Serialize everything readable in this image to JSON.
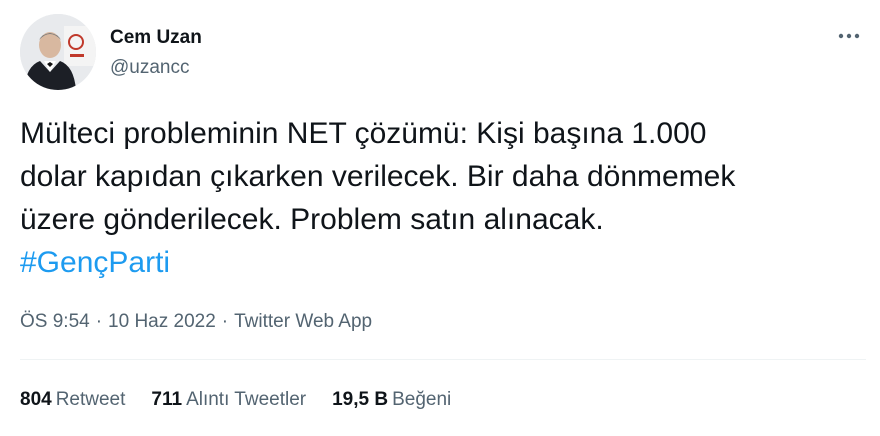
{
  "author": {
    "display_name": "Cem Uzan",
    "handle": "@uzancc"
  },
  "tweet": {
    "text_lines": [
      "Mülteci probleminin NET çözümü: Kişi başına 1.000",
      "dolar kapıdan çıkarken verilecek. Bir daha dönmemek",
      "üzere gönderilecek. Problem satın alınacak."
    ],
    "hashtag": "#GençParti"
  },
  "meta": {
    "time": "ÖS 9:54",
    "separator": "·",
    "date": "10 Haz 2022",
    "source": "Twitter Web App"
  },
  "stats": {
    "retweets": {
      "count": "804",
      "label": "Retweet"
    },
    "quotes": {
      "count": "711",
      "label": "Alıntı Tweetler"
    },
    "likes": {
      "count": "19,5 B",
      "label": "Beğeni"
    }
  },
  "icons": {
    "more": "more-horizontal-icon"
  },
  "colors": {
    "link": "#1d9bf0",
    "secondary_text": "#536471",
    "primary_text": "#0f1419",
    "divider": "#eff3f4"
  }
}
